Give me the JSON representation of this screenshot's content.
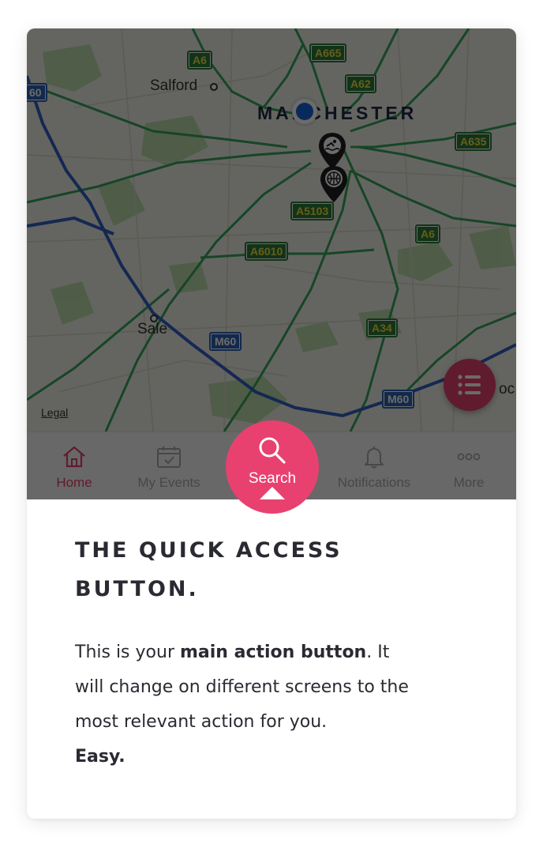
{
  "map": {
    "places": {
      "salford": "Salford",
      "manchester": "MANCHESTER",
      "sale": "Sale",
      "edge_label": "oc",
      "legal": "Legal"
    },
    "roads": {
      "a6_top": "A6",
      "a665": "A665",
      "a62": "A62",
      "a635": "A635",
      "a5103": "A5103",
      "a6_right": "A6",
      "a6010": "A6010",
      "a34": "A34",
      "m60_left": "M60",
      "m60_right": "M60",
      "edge_m60": "60"
    },
    "pins": [
      "swimming-pin-icon",
      "basketball-pin-icon"
    ],
    "colors": {
      "land": "#eef0e7",
      "park": "#b8dba6",
      "road_green": "#37a55b",
      "road_blue": "#3461c3"
    }
  },
  "tabs": [
    {
      "label": "Home",
      "icon": "home-icon",
      "active": true
    },
    {
      "label": "My Events",
      "icon": "calendar-icon",
      "active": false
    },
    {
      "label": "Notifications",
      "icon": "bell-icon",
      "active": false
    },
    {
      "label": "More",
      "icon": "more-dots-icon",
      "active": false
    }
  ],
  "quick_button": {
    "label": "Search",
    "icon": "search-icon"
  },
  "tooltip": {
    "title": "THE QUICK ACCESS BUTTON.",
    "body": {
      "part1": "This is your ",
      "bold1": "main action button",
      "part2": ". It will change on different screens to the most relevant action for you.",
      "bold2": "Easy."
    }
  },
  "colors": {
    "accent": "#e8416f",
    "text_dark": "#2a2a33",
    "tab_inactive": "#a9a9a9"
  }
}
